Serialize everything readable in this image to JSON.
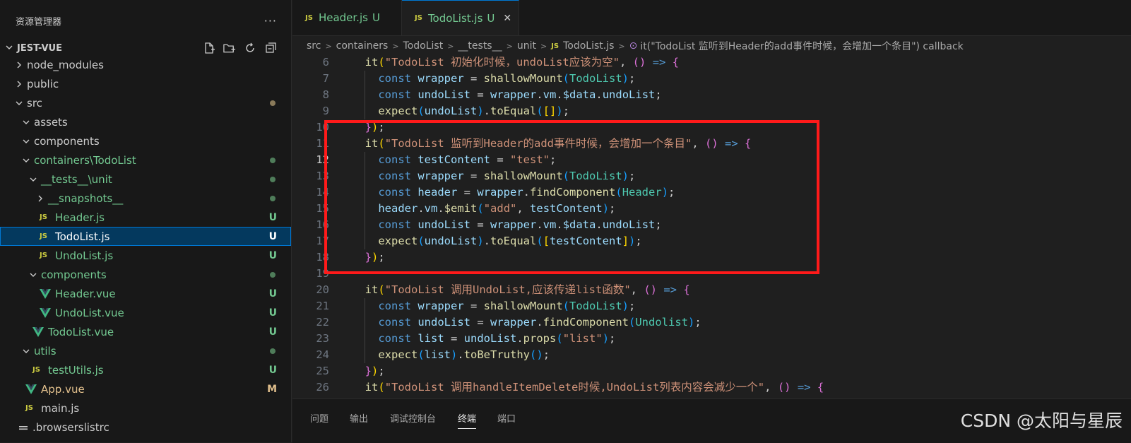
{
  "explorer": {
    "title": "资源管理器",
    "more": "···",
    "root": "JEST-VUE",
    "items": [
      {
        "label": "node_modules",
        "type": "folder",
        "open": false,
        "depth": 0,
        "status": "",
        "dot": ""
      },
      {
        "label": "public",
        "type": "folder",
        "open": false,
        "depth": 0,
        "status": "",
        "dot": ""
      },
      {
        "label": "src",
        "type": "folder",
        "open": true,
        "depth": 0,
        "status": "",
        "dot": "#8a7a5a"
      },
      {
        "label": "assets",
        "type": "folder",
        "open": true,
        "depth": 1,
        "status": "",
        "dot": ""
      },
      {
        "label": "components",
        "type": "folder",
        "open": true,
        "depth": 1,
        "status": "",
        "dot": ""
      },
      {
        "label": "containers\\TodoList",
        "type": "folder",
        "open": true,
        "depth": 1,
        "status": "",
        "dot": "#4f7d5a",
        "green": true
      },
      {
        "label": "__tests__\\unit",
        "type": "folder",
        "open": true,
        "depth": 2,
        "status": "",
        "dot": "#4f7d5a",
        "green": true
      },
      {
        "label": "__snapshots__",
        "type": "folder",
        "open": false,
        "depth": 3,
        "status": "",
        "dot": "#4f7d5a",
        "green": true
      },
      {
        "label": "Header.js",
        "type": "js",
        "depth": 3,
        "status": "U",
        "dot": "",
        "green": true
      },
      {
        "label": "TodoList.js",
        "type": "js",
        "depth": 3,
        "status": "U",
        "dot": "",
        "selected": true
      },
      {
        "label": "UndoList.js",
        "type": "js",
        "depth": 3,
        "status": "U",
        "dot": "",
        "green": true
      },
      {
        "label": "components",
        "type": "folder",
        "open": true,
        "depth": 2,
        "status": "",
        "dot": "#4f7d5a",
        "green": true
      },
      {
        "label": "Header.vue",
        "type": "vue",
        "depth": 3,
        "status": "U",
        "dot": "",
        "green": true
      },
      {
        "label": "UndoList.vue",
        "type": "vue",
        "depth": 3,
        "status": "U",
        "dot": "",
        "green": true
      },
      {
        "label": "TodoList.vue",
        "type": "vue",
        "depth": 2,
        "status": "U",
        "dot": "",
        "green": true
      },
      {
        "label": "utils",
        "type": "folder",
        "open": true,
        "depth": 1,
        "status": "",
        "dot": "#4f7d5a",
        "green": true
      },
      {
        "label": "testUtils.js",
        "type": "js",
        "depth": 2,
        "status": "U",
        "dot": "",
        "green": true
      },
      {
        "label": "App.vue",
        "type": "vue",
        "depth": 1,
        "status": "M",
        "dot": "",
        "amber": true
      },
      {
        "label": "main.js",
        "type": "js",
        "depth": 1,
        "status": "",
        "dot": ""
      },
      {
        "label": ".browserslistrc",
        "type": "config",
        "depth": 0,
        "status": "",
        "dot": ""
      }
    ]
  },
  "tabs": [
    {
      "label": "Header.js",
      "status": "U",
      "active": false
    },
    {
      "label": "TodoList.js",
      "status": "U",
      "active": true,
      "close": "✕"
    }
  ],
  "breadcrumb": {
    "parts": [
      "src",
      "containers",
      "TodoList",
      "__tests__",
      "unit"
    ],
    "file": "TodoList.js",
    "symbol": "it(\"TodoList 监听到Header的add事件时候，会增加一个条目\") callback"
  },
  "editor": {
    "current_line": "12",
    "lines": [
      {
        "n": "6",
        "tokens": [
          [
            "p",
            "  "
          ],
          [
            "f",
            "it"
          ],
          [
            "br1",
            "("
          ],
          [
            "s",
            "\"TodoList 初始化时候，undoList应该为空\""
          ],
          [
            "p",
            ", "
          ],
          [
            "br2",
            "()"
          ],
          [
            "p",
            " "
          ],
          [
            "k",
            "=>"
          ],
          [
            "p",
            " "
          ],
          [
            "br2",
            "{"
          ]
        ]
      },
      {
        "n": "7",
        "tokens": [
          [
            "p",
            "    "
          ],
          [
            "k",
            "const"
          ],
          [
            "p",
            " "
          ],
          [
            "v",
            "wrapper"
          ],
          [
            "p",
            " = "
          ],
          [
            "f",
            "shallowMount"
          ],
          [
            "br3",
            "("
          ],
          [
            "c",
            "TodoList"
          ],
          [
            "br3",
            ")"
          ],
          [
            "p",
            ";"
          ]
        ]
      },
      {
        "n": "8",
        "tokens": [
          [
            "p",
            "    "
          ],
          [
            "k",
            "const"
          ],
          [
            "p",
            " "
          ],
          [
            "v",
            "undoList"
          ],
          [
            "p",
            " = "
          ],
          [
            "v",
            "wrapper"
          ],
          [
            "p",
            "."
          ],
          [
            "v",
            "vm"
          ],
          [
            "p",
            "."
          ],
          [
            "v",
            "$data"
          ],
          [
            "p",
            "."
          ],
          [
            "v",
            "undoList"
          ],
          [
            "p",
            ";"
          ]
        ]
      },
      {
        "n": "9",
        "tokens": [
          [
            "p",
            "    "
          ],
          [
            "f",
            "expect"
          ],
          [
            "br3",
            "("
          ],
          [
            "v",
            "undoList"
          ],
          [
            "br3",
            ")"
          ],
          [
            "p",
            "."
          ],
          [
            "f",
            "toEqual"
          ],
          [
            "br3",
            "("
          ],
          [
            "br1",
            "[]"
          ],
          [
            "br3",
            ")"
          ],
          [
            "p",
            ";"
          ]
        ]
      },
      {
        "n": "10",
        "tokens": [
          [
            "p",
            "  "
          ],
          [
            "br2",
            "}"
          ],
          [
            "br1",
            ")"
          ],
          [
            "p",
            ";"
          ]
        ]
      },
      {
        "n": "11",
        "tokens": [
          [
            "p",
            "  "
          ],
          [
            "f",
            "it"
          ],
          [
            "br1",
            "("
          ],
          [
            "s",
            "\"TodoList 监听到Header的add事件时候，会增加一个条目\""
          ],
          [
            "p",
            ", "
          ],
          [
            "br2",
            "()"
          ],
          [
            "p",
            " "
          ],
          [
            "k",
            "=>"
          ],
          [
            "p",
            " "
          ],
          [
            "br2",
            "{"
          ]
        ]
      },
      {
        "n": "12",
        "tokens": [
          [
            "p",
            "    "
          ],
          [
            "k",
            "const"
          ],
          [
            "p",
            " "
          ],
          [
            "v",
            "testContent"
          ],
          [
            "p",
            " = "
          ],
          [
            "s",
            "\"test\""
          ],
          [
            "p",
            ";"
          ]
        ]
      },
      {
        "n": "13",
        "tokens": [
          [
            "p",
            "    "
          ],
          [
            "k",
            "const"
          ],
          [
            "p",
            " "
          ],
          [
            "v",
            "wrapper"
          ],
          [
            "p",
            " = "
          ],
          [
            "f",
            "shallowMount"
          ],
          [
            "br3",
            "("
          ],
          [
            "c",
            "TodoList"
          ],
          [
            "br3",
            ")"
          ],
          [
            "p",
            ";"
          ]
        ]
      },
      {
        "n": "14",
        "tokens": [
          [
            "p",
            "    "
          ],
          [
            "k",
            "const"
          ],
          [
            "p",
            " "
          ],
          [
            "v",
            "header"
          ],
          [
            "p",
            " = "
          ],
          [
            "v",
            "wrapper"
          ],
          [
            "p",
            "."
          ],
          [
            "f",
            "findComponent"
          ],
          [
            "br3",
            "("
          ],
          [
            "c",
            "Header"
          ],
          [
            "br3",
            ")"
          ],
          [
            "p",
            ";"
          ]
        ]
      },
      {
        "n": "15",
        "tokens": [
          [
            "p",
            "    "
          ],
          [
            "v",
            "header"
          ],
          [
            "p",
            "."
          ],
          [
            "v",
            "vm"
          ],
          [
            "p",
            "."
          ],
          [
            "f",
            "$emit"
          ],
          [
            "br3",
            "("
          ],
          [
            "s",
            "\"add\""
          ],
          [
            "p",
            ", "
          ],
          [
            "v",
            "testContent"
          ],
          [
            "br3",
            ")"
          ],
          [
            "p",
            ";"
          ]
        ]
      },
      {
        "n": "16",
        "tokens": [
          [
            "p",
            "    "
          ],
          [
            "k",
            "const"
          ],
          [
            "p",
            " "
          ],
          [
            "v",
            "undoList"
          ],
          [
            "p",
            " = "
          ],
          [
            "v",
            "wrapper"
          ],
          [
            "p",
            "."
          ],
          [
            "v",
            "vm"
          ],
          [
            "p",
            "."
          ],
          [
            "v",
            "$data"
          ],
          [
            "p",
            "."
          ],
          [
            "v",
            "undoList"
          ],
          [
            "p",
            ";"
          ]
        ]
      },
      {
        "n": "17",
        "tokens": [
          [
            "p",
            "    "
          ],
          [
            "f",
            "expect"
          ],
          [
            "br3",
            "("
          ],
          [
            "v",
            "undoList"
          ],
          [
            "br3",
            ")"
          ],
          [
            "p",
            "."
          ],
          [
            "f",
            "toEqual"
          ],
          [
            "br3",
            "("
          ],
          [
            "br1",
            "["
          ],
          [
            "v",
            "testContent"
          ],
          [
            "br1",
            "]"
          ],
          [
            "br3",
            ")"
          ],
          [
            "p",
            ";"
          ]
        ]
      },
      {
        "n": "18",
        "tokens": [
          [
            "p",
            "  "
          ],
          [
            "br2",
            "}"
          ],
          [
            "br1",
            ")"
          ],
          [
            "p",
            ";"
          ]
        ]
      },
      {
        "n": "19",
        "tokens": []
      },
      {
        "n": "20",
        "tokens": [
          [
            "p",
            "  "
          ],
          [
            "f",
            "it"
          ],
          [
            "br1",
            "("
          ],
          [
            "s",
            "\"TodoList 调用UndoList,应该传递list函数\""
          ],
          [
            "p",
            ", "
          ],
          [
            "br2",
            "()"
          ],
          [
            "p",
            " "
          ],
          [
            "k",
            "=>"
          ],
          [
            "p",
            " "
          ],
          [
            "br2",
            "{"
          ]
        ]
      },
      {
        "n": "21",
        "tokens": [
          [
            "p",
            "    "
          ],
          [
            "k",
            "const"
          ],
          [
            "p",
            " "
          ],
          [
            "v",
            "wrapper"
          ],
          [
            "p",
            " = "
          ],
          [
            "f",
            "shallowMount"
          ],
          [
            "br3",
            "("
          ],
          [
            "c",
            "TodoList"
          ],
          [
            "br3",
            ")"
          ],
          [
            "p",
            ";"
          ]
        ]
      },
      {
        "n": "22",
        "tokens": [
          [
            "p",
            "    "
          ],
          [
            "k",
            "const"
          ],
          [
            "p",
            " "
          ],
          [
            "v",
            "undoList"
          ],
          [
            "p",
            " = "
          ],
          [
            "v",
            "wrapper"
          ],
          [
            "p",
            "."
          ],
          [
            "f",
            "findComponent"
          ],
          [
            "br3",
            "("
          ],
          [
            "c",
            "Undolist"
          ],
          [
            "br3",
            ")"
          ],
          [
            "p",
            ";"
          ]
        ]
      },
      {
        "n": "23",
        "tokens": [
          [
            "p",
            "    "
          ],
          [
            "k",
            "const"
          ],
          [
            "p",
            " "
          ],
          [
            "v",
            "list"
          ],
          [
            "p",
            " = "
          ],
          [
            "v",
            "undoList"
          ],
          [
            "p",
            "."
          ],
          [
            "f",
            "props"
          ],
          [
            "br3",
            "("
          ],
          [
            "s",
            "\"list\""
          ],
          [
            "br3",
            ")"
          ],
          [
            "p",
            ";"
          ]
        ]
      },
      {
        "n": "24",
        "tokens": [
          [
            "p",
            "    "
          ],
          [
            "f",
            "expect"
          ],
          [
            "br3",
            "("
          ],
          [
            "v",
            "list"
          ],
          [
            "br3",
            ")"
          ],
          [
            "p",
            "."
          ],
          [
            "f",
            "toBeTruthy"
          ],
          [
            "br3",
            "()"
          ],
          [
            "p",
            ";"
          ]
        ]
      },
      {
        "n": "25",
        "tokens": [
          [
            "p",
            "  "
          ],
          [
            "br2",
            "}"
          ],
          [
            "br1",
            ")"
          ],
          [
            "p",
            ";"
          ]
        ]
      },
      {
        "n": "26",
        "tokens": [
          [
            "p",
            "  "
          ],
          [
            "f",
            "it"
          ],
          [
            "br1",
            "("
          ],
          [
            "s",
            "\"TodoList 调用handleItemDelete时候,UndoList列表内容会减少一个\""
          ],
          [
            "p",
            ", "
          ],
          [
            "br2",
            "()"
          ],
          [
            "p",
            " "
          ],
          [
            "k",
            "=>"
          ],
          [
            "p",
            " "
          ],
          [
            "br2",
            "{"
          ]
        ]
      }
    ]
  },
  "panel": {
    "tabs": [
      "问题",
      "输出",
      "调试控制台",
      "终端",
      "端口"
    ],
    "active": "终端"
  },
  "watermark": "CSDN @太阳与星辰",
  "colors": {
    "accent": "#0078d4",
    "untracked": "#73c991",
    "modified": "#e2c08d",
    "highlight_box": "#ff1a1a"
  }
}
